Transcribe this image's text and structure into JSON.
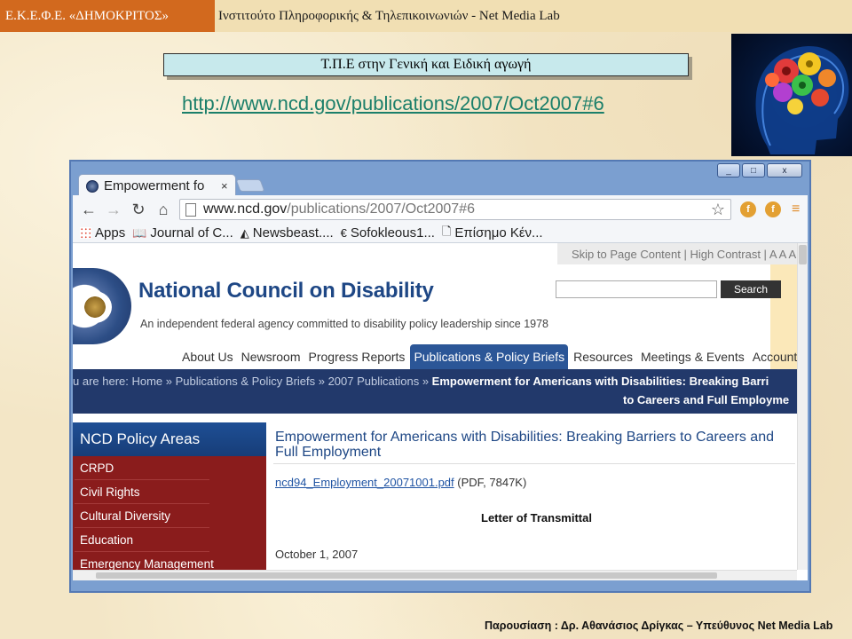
{
  "slide": {
    "header_left": "Ε.Κ.Ε.Φ.Ε. «ΔΗΜΟΚΡΙΤΟΣ»",
    "header_right": "Ινστιτούτο Πληροφορικής & Τηλεπικοινωνιών - Net Media Lab",
    "title": "Τ.Π.Ε στην Γενική και Ειδική αγωγή",
    "url": "http://www.ncd.gov/publications/2007/Oct2007#6",
    "footer": "Παρουσίαση : Δρ. Αθανάσιος Δρίγκας – Υπεύθυνος Net Media Lab"
  },
  "browser": {
    "tab_title": "Empowerment fo",
    "tab_close": "×",
    "window_buttons": {
      "minimize": "_",
      "maximize": "□",
      "close": "x"
    },
    "address_host": "www.ncd.gov",
    "address_path": "/publications/2007/Oct2007#6",
    "bookmarks": [
      {
        "icon": "apps-icon",
        "label": "Apps"
      },
      {
        "icon": "book-icon",
        "label": "Journal of C..."
      },
      {
        "icon": "newsbeast-icon",
        "label": "Newsbeast...."
      },
      {
        "icon": "euro-icon",
        "label": "Sofokleous1..."
      },
      {
        "icon": "page-icon",
        "label": "Επίσημο Κέν..."
      }
    ]
  },
  "ncd": {
    "utility_links": "Skip to Page Content | High Contrast | A A A",
    "org_name": "National Council on Disability",
    "tagline": "An independent federal agency committed to disability policy leadership since 1978",
    "search_button": "Search",
    "search_placeholder": "",
    "nav": [
      "About Us",
      "Newsroom",
      "Progress Reports",
      "Publications & Policy Briefs",
      "Resources",
      "Meetings & Events",
      "Accountab"
    ],
    "nav_active_index": 3,
    "breadcrumb_prefix": "u are here: Home » Publications & Policy Briefs » 2007 Publications » ",
    "breadcrumb_current": "Empowerment for Americans with Disabilities: Breaking Barri",
    "breadcrumb_line2": "to Careers and Full Employme",
    "policy_title": "NCD Policy Areas",
    "policy_items": [
      "CRPD",
      "Civil Rights",
      "Cultural Diversity",
      "Education",
      "Emergency Management"
    ],
    "article_title": "Empowerment for Americans with Disabilities: Breaking Barriers to Careers and Full Employment",
    "pdf_link": "ncd94_Employment_20071001.pdf",
    "pdf_meta": " (PDF, 7847K)",
    "letter_heading": "Letter of Transmittal",
    "letter_date": "October 1, 2007"
  },
  "colors": {
    "header_orange": "#d2691e",
    "title_box": "#c7e9ec",
    "url_green": "#1b7f6a",
    "ncd_blue": "#1e4785",
    "nav_active": "#2b5697",
    "breadcrumb_band": "#22396b",
    "policy_red": "#8a1c1c"
  }
}
